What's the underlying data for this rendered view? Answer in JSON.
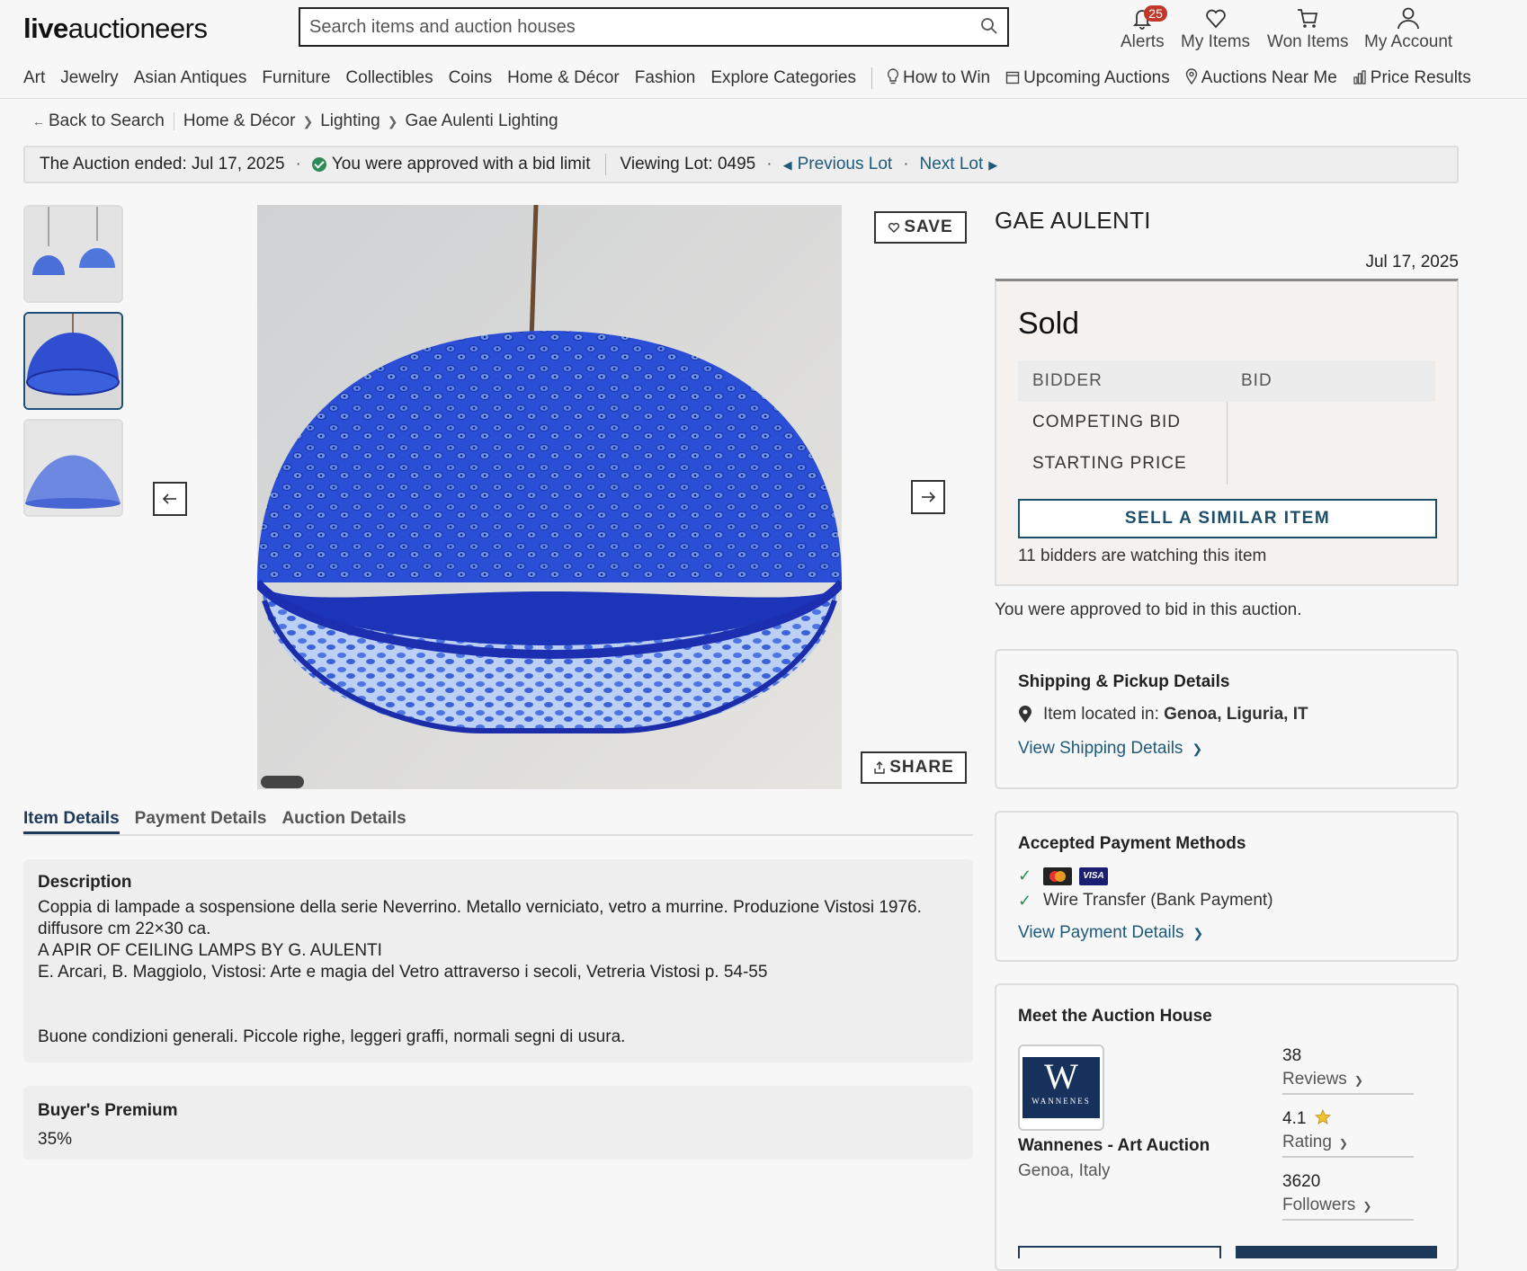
{
  "header": {
    "logo_bold": "live",
    "logo_rest": "auctioneers",
    "search_placeholder": "Search items and auction houses",
    "alerts_label": "Alerts",
    "alerts_count": "25",
    "my_items_label": "My Items",
    "won_items_label": "Won Items",
    "my_account_label": "My Account"
  },
  "nav": {
    "categories": [
      "Art",
      "Jewelry",
      "Asian Antiques",
      "Furniture",
      "Collectibles",
      "Coins",
      "Home & Décor",
      "Fashion",
      "Explore Categories"
    ],
    "how_to_win": "How to Win",
    "upcoming": "Upcoming Auctions",
    "near_me": "Auctions Near Me",
    "price_results": "Price Results"
  },
  "breadcrumb": {
    "back": "Back to Search",
    "items": [
      "Home & Décor",
      "Lighting",
      "Gae Aulenti Lighting"
    ]
  },
  "status": {
    "ended": "The Auction ended: Jul 17, 2025",
    "approved": "You were approved with a bid limit",
    "viewing": "Viewing Lot: 0495",
    "prev": "Previous Lot",
    "next": "Next Lot"
  },
  "media": {
    "save_label": "SAVE",
    "share_label": "SHARE"
  },
  "tabs": [
    "Item Details",
    "Payment Details",
    "Auction Details"
  ],
  "description": {
    "title": "Description",
    "lines": [
      "Coppia di lampade a sospensione della serie Neverrino. Metallo verniciato, vetro a murrine. Produzione Vistosi 1976.",
      "diffusore cm 22×30 ca.",
      "A APIR OF CEILING LAMPS BY G. AULENTI",
      "E. Arcari, B. Maggiolo, Vistosi: Arte e magia del Vetro attraverso i secoli, Vetreria Vistosi p. 54-55",
      "Buone condizioni generali. Piccole righe, leggeri graffi, normali segni di usura."
    ]
  },
  "buyers_premium": {
    "title": "Buyer's Premium",
    "value": "35%"
  },
  "lot": {
    "maker": "GAE AULENTI",
    "date": "Jul 17, 2025",
    "status": "Sold",
    "bidder_header": "BIDDER",
    "bid_header": "BID",
    "competing_bid": "COMPETING BID",
    "starting_price": "STARTING PRICE",
    "sell_similar": "SELL A SIMILAR ITEM",
    "watching": "11 bidders are watching this item",
    "approved_note": "You were approved to bid in this auction."
  },
  "shipping": {
    "title": "Shipping & Pickup Details",
    "located_label": "Item located in:",
    "location": "Genoa, Liguria, IT",
    "link": "View Shipping Details"
  },
  "payment": {
    "title": "Accepted Payment Methods",
    "visa": "VISA",
    "wire": "Wire Transfer (Bank Payment)",
    "link": "View Payment Details"
  },
  "house": {
    "title": "Meet the Auction House",
    "logo_letter": "W",
    "logo_word": "WANNENES",
    "name": "Wannenes - Art Auction",
    "location": "Genoa, Italy",
    "reviews_count": "38",
    "reviews_label": "Reviews",
    "rating": "4.1",
    "rating_label": "Rating",
    "followers_count": "3620",
    "followers_label": "Followers"
  },
  "colors": {
    "accent": "#1e5a7a",
    "badge": "#c0392b",
    "approved_check": "#2e8b57",
    "house_logo_bg": "#16325c"
  }
}
